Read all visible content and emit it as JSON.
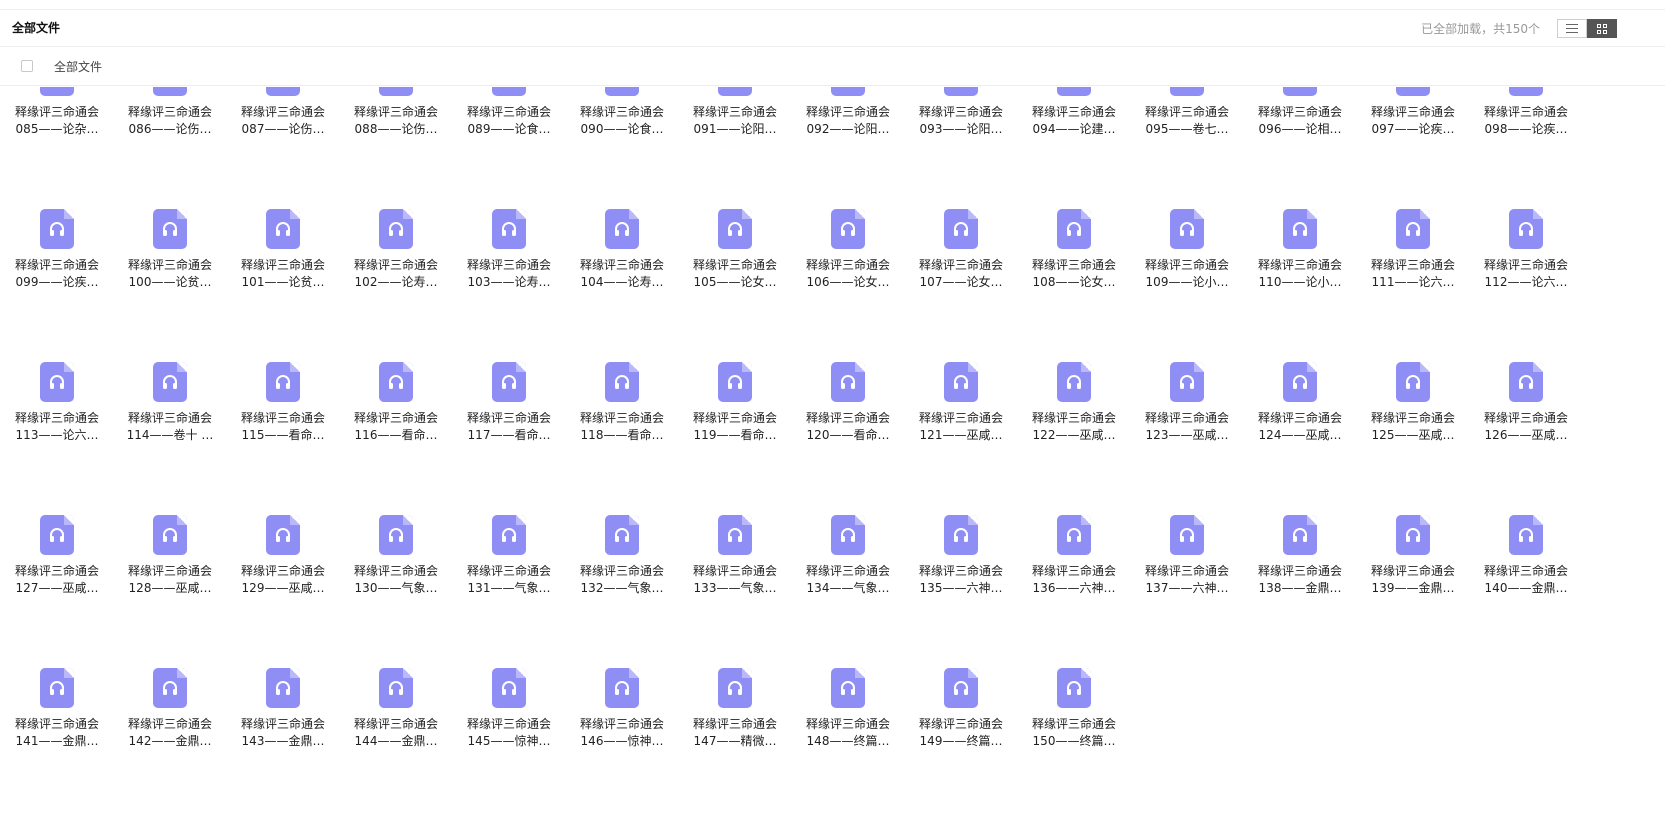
{
  "header": {
    "title": "全部文件",
    "status": "已全部加载，共150个"
  },
  "subheader": {
    "label": "全部文件"
  },
  "view_toggle": {
    "options": [
      "list-view",
      "grid-view"
    ],
    "selected": "grid-view"
  },
  "colors": {
    "icon_bg": "#8f8ef5",
    "divider": "#eeeeee"
  },
  "files": [
    {
      "line1": "释缘评三命通会",
      "line2": "085——论杂…"
    },
    {
      "line1": "释缘评三命通会",
      "line2": "086——论伤…"
    },
    {
      "line1": "释缘评三命通会",
      "line2": "087——论伤…"
    },
    {
      "line1": "释缘评三命通会",
      "line2": "088——论伤…"
    },
    {
      "line1": "释缘评三命通会",
      "line2": "089——论食…"
    },
    {
      "line1": "释缘评三命通会",
      "line2": "090——论食…"
    },
    {
      "line1": "释缘评三命通会",
      "line2": "091——论阳…"
    },
    {
      "line1": "释缘评三命通会",
      "line2": "092——论阳…"
    },
    {
      "line1": "释缘评三命通会",
      "line2": "093——论阳…"
    },
    {
      "line1": "释缘评三命通会",
      "line2": "094——论建…"
    },
    {
      "line1": "释缘评三命通会",
      "line2": "095——卷七…"
    },
    {
      "line1": "释缘评三命通会",
      "line2": "096——论相…"
    },
    {
      "line1": "释缘评三命通会",
      "line2": "097——论疾…"
    },
    {
      "line1": "释缘评三命通会",
      "line2": "098——论疾…"
    },
    {
      "line1": "释缘评三命通会",
      "line2": "099——论疾…"
    },
    {
      "line1": "释缘评三命通会",
      "line2": "100——论贫…"
    },
    {
      "line1": "释缘评三命通会",
      "line2": "101——论贫…"
    },
    {
      "line1": "释缘评三命通会",
      "line2": "102——论寿…"
    },
    {
      "line1": "释缘评三命通会",
      "line2": "103——论寿…"
    },
    {
      "line1": "释缘评三命通会",
      "line2": "104——论寿…"
    },
    {
      "line1": "释缘评三命通会",
      "line2": "105——论女…"
    },
    {
      "line1": "释缘评三命通会",
      "line2": "106——论女…"
    },
    {
      "line1": "释缘评三命通会",
      "line2": "107——论女…"
    },
    {
      "line1": "释缘评三命通会",
      "line2": "108——论女…"
    },
    {
      "line1": "释缘评三命通会",
      "line2": "109——论小…"
    },
    {
      "line1": "释缘评三命通会",
      "line2": "110——论小…"
    },
    {
      "line1": "释缘评三命通会",
      "line2": "111——论六…"
    },
    {
      "line1": "释缘评三命通会",
      "line2": "112——论六…"
    },
    {
      "line1": "释缘评三命通会",
      "line2": "113——论六…"
    },
    {
      "line1": "释缘评三命通会",
      "line2": "114——卷十 …"
    },
    {
      "line1": "释缘评三命通会",
      "line2": "115——看命…"
    },
    {
      "line1": "释缘评三命通会",
      "line2": "116——看命…"
    },
    {
      "line1": "释缘评三命通会",
      "line2": "117——看命…"
    },
    {
      "line1": "释缘评三命通会",
      "line2": "118——看命…"
    },
    {
      "line1": "释缘评三命通会",
      "line2": "119——看命…"
    },
    {
      "line1": "释缘评三命通会",
      "line2": "120——看命…"
    },
    {
      "line1": "释缘评三命通会",
      "line2": "121——巫咸…"
    },
    {
      "line1": "释缘评三命通会",
      "line2": "122——巫咸…"
    },
    {
      "line1": "释缘评三命通会",
      "line2": "123——巫咸…"
    },
    {
      "line1": "释缘评三命通会",
      "line2": "124——巫咸…"
    },
    {
      "line1": "释缘评三命通会",
      "line2": "125——巫咸…"
    },
    {
      "line1": "释缘评三命通会",
      "line2": "126——巫咸…"
    },
    {
      "line1": "释缘评三命通会",
      "line2": "127——巫咸…"
    },
    {
      "line1": "释缘评三命通会",
      "line2": "128——巫咸…"
    },
    {
      "line1": "释缘评三命通会",
      "line2": "129——巫咸…"
    },
    {
      "line1": "释缘评三命通会",
      "line2": "130——气象…"
    },
    {
      "line1": "释缘评三命通会",
      "line2": "131——气象…"
    },
    {
      "line1": "释缘评三命通会",
      "line2": "132——气象…"
    },
    {
      "line1": "释缘评三命通会",
      "line2": "133——气象…"
    },
    {
      "line1": "释缘评三命通会",
      "line2": "134——气象…"
    },
    {
      "line1": "释缘评三命通会",
      "line2": "135——六神…"
    },
    {
      "line1": "释缘评三命通会",
      "line2": "136——六神…"
    },
    {
      "line1": "释缘评三命通会",
      "line2": "137——六神…"
    },
    {
      "line1": "释缘评三命通会",
      "line2": "138——金鼎…"
    },
    {
      "line1": "释缘评三命通会",
      "line2": "139——金鼎…"
    },
    {
      "line1": "释缘评三命通会",
      "line2": "140——金鼎…"
    },
    {
      "line1": "释缘评三命通会",
      "line2": "141——金鼎…"
    },
    {
      "line1": "释缘评三命通会",
      "line2": "142——金鼎…"
    },
    {
      "line1": "释缘评三命通会",
      "line2": "143——金鼎…"
    },
    {
      "line1": "释缘评三命通会",
      "line2": "144——金鼎…"
    },
    {
      "line1": "释缘评三命通会",
      "line2": "145——惊神…"
    },
    {
      "line1": "释缘评三命通会",
      "line2": "146——惊神…"
    },
    {
      "line1": "释缘评三命通会",
      "line2": "147——精微…"
    },
    {
      "line1": "释缘评三命通会",
      "line2": "148——终篇…"
    },
    {
      "line1": "释缘评三命通会",
      "line2": "149——终篇…"
    },
    {
      "line1": "释缘评三命通会",
      "line2": "150——终篇…"
    }
  ]
}
